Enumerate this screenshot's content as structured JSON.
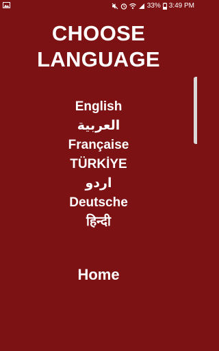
{
  "status_bar": {
    "battery": "33%",
    "time": "3:49 PM"
  },
  "title": "CHOOSE\nLANGUAGE",
  "languages": [
    "English",
    "العربية",
    "Française",
    "TÜRKİYE",
    "اردو",
    "Deutsche",
    "हिन्दी"
  ],
  "home_label": "Home"
}
